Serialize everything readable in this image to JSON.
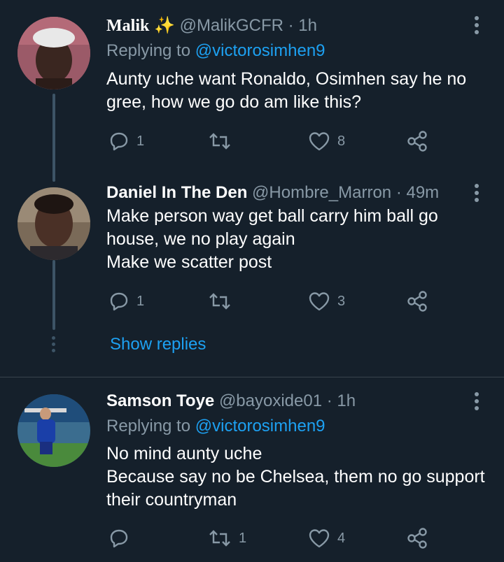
{
  "tweets": [
    {
      "name": "Malik",
      "badge": "✨",
      "handle": "@MalikGCFR",
      "time": "· 1h",
      "replying_prefix": "Replying to",
      "replying_to": "@victorosimhen9",
      "text_lines": [
        "Aunty uche want Ronaldo, Osimhen say he no",
        "gree, how we go do am like this?"
      ],
      "reply_count": "1",
      "retweet_count": "",
      "like_count": "8"
    },
    {
      "name": "Daniel In The Den",
      "handle": "@Hombre_Marron",
      "time": "· 49m",
      "text_lines": [
        "Make person way get ball carry him ball go",
        "house, we no play again",
        "Make we scatter post"
      ],
      "reply_count": "1",
      "retweet_count": "",
      "like_count": "3"
    },
    {
      "name": "Samson Toye",
      "handle": "@bayoxide01",
      "time": "· 1h",
      "replying_prefix": "Replying to",
      "replying_to": "@victorosimhen9",
      "text_lines": [
        "No mind aunty uche",
        "Because say no be Chelsea, them no go support",
        "their countryman"
      ],
      "reply_count": "",
      "retweet_count": "1",
      "like_count": "4"
    }
  ],
  "show_replies": "Show replies",
  "colors": {
    "background": "#15202b",
    "muted": "#8899a6",
    "accent": "#1da1f2",
    "divider": "#38444d"
  }
}
